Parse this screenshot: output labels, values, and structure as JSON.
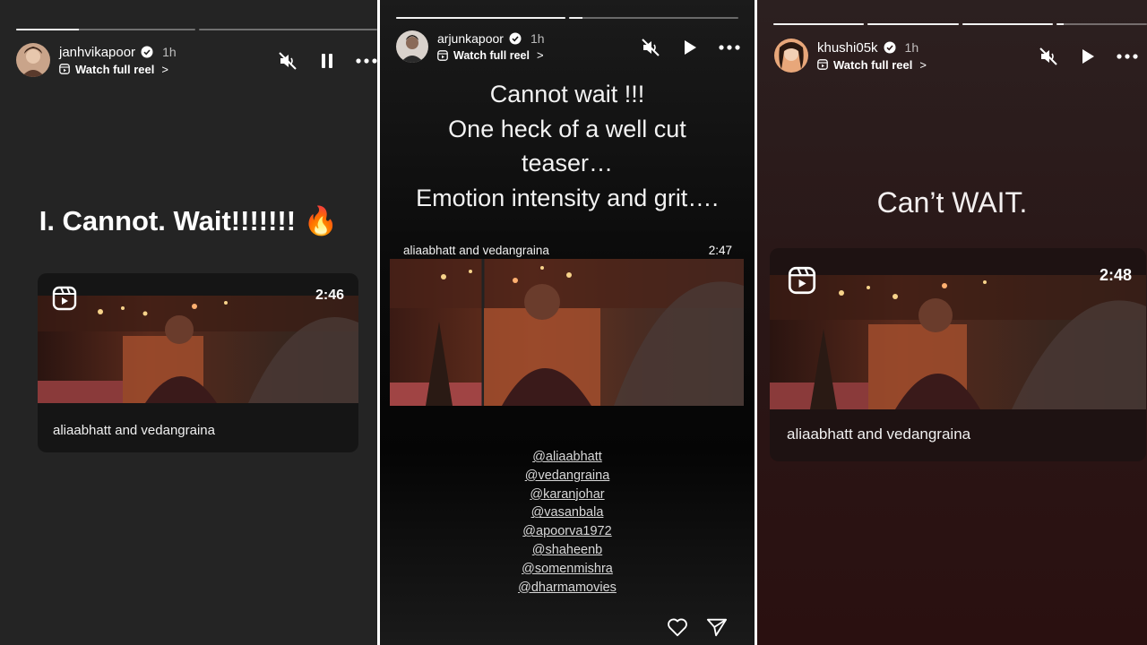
{
  "stories": [
    {
      "username": "janhvikapoor",
      "time": "1h",
      "watch_label": "Watch full reel",
      "chevron": ">",
      "progress": [
        0.35,
        0
      ],
      "text_lines": [
        "I. Cannot. Wait!!!!!!! 🔥"
      ],
      "reel": {
        "duration": "2:46",
        "caption": "aliaabhatt and vedangraina"
      },
      "icons": {
        "mute": "speaker-muted-icon",
        "play_state": "pause-icon",
        "more": "more-icon"
      }
    },
    {
      "username": "arjunkapoor",
      "time": "1h",
      "watch_label": "Watch full reel",
      "chevron": ">",
      "progress": [
        1,
        0.08
      ],
      "text_lines": [
        "Cannot wait !!!",
        "One heck of a well cut",
        "teaser…",
        "Emotion intensity and grit…."
      ],
      "reel": {
        "duration": "2:47",
        "caption": "aliaabhatt and vedangraina"
      },
      "mentions": [
        "@aliaabhatt",
        "@vedangraina",
        "@karanjohar",
        "@vasanbala",
        "@apoorva1972",
        "@shaheenb",
        "@somenmishra",
        "@dharmamovies"
      ],
      "icons": {
        "mute": "speaker-muted-icon",
        "play_state": "play-icon",
        "more": "more-icon",
        "like": "heart-icon",
        "share": "send-icon"
      }
    },
    {
      "username": "khushi05k",
      "time": "1h",
      "watch_label": "Watch full reel",
      "chevron": ">",
      "progress": [
        1,
        1,
        1,
        0.08
      ],
      "text_lines": [
        "Can’t WAIT."
      ],
      "reel": {
        "duration": "2:48",
        "caption": "aliaabhatt and vedangraina"
      },
      "icons": {
        "mute": "speaker-muted-icon",
        "play_state": "play-icon",
        "more": "more-icon"
      }
    }
  ],
  "colors": {
    "panel1_bg": "#242424",
    "panel2_bg": "#0b0b0b",
    "panel3_bg": "#2a1414",
    "link": "#d8d8d8"
  }
}
